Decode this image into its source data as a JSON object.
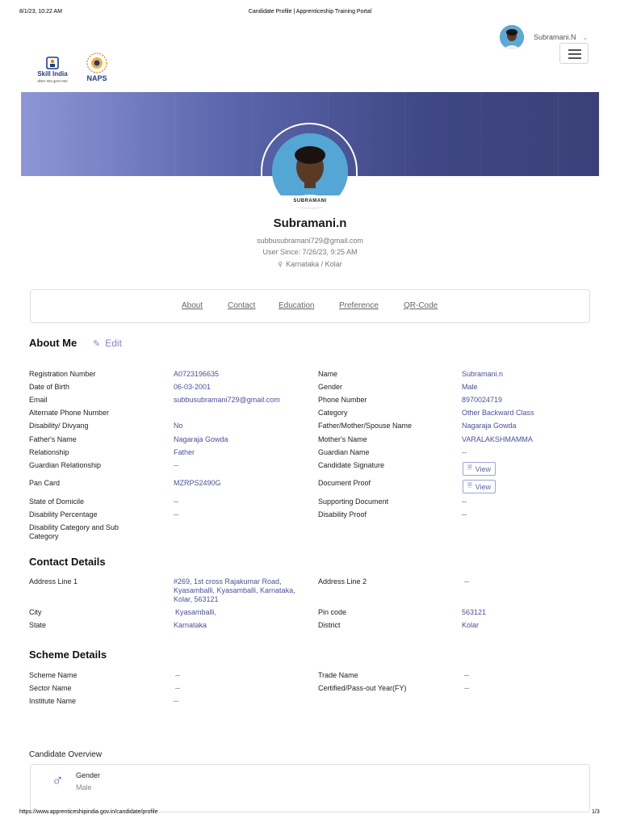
{
  "print": {
    "datetime": "8/1/23, 10:22 AM",
    "page_title": "Candidate Profile | Apprenticeship Training Portal",
    "url": "https://www.apprenticeshipindia.gov.in/candidate/profile",
    "page_number": "1/3"
  },
  "header": {
    "user_name": "Subramani.N",
    "logo_skill_text": "Skill India",
    "logo_skill_sub": "कौशल भारत-कुशल भारत",
    "logo_naps_text": "NAPS"
  },
  "profile": {
    "photo_caption": "SUBRAMANI",
    "name": "Subramani.n",
    "email": "subbusubramani729@gmail.com",
    "user_since": "User Since: 7/26/23, 9:25 AM",
    "location": "Karnataka / Kolar"
  },
  "tabs": [
    "About",
    "Contact",
    "Education",
    "Preference",
    "QR-Code"
  ],
  "about": {
    "title": "About Me",
    "edit_label": "Edit",
    "left": [
      {
        "label": "Registration Number",
        "value": "A0723196635"
      },
      {
        "label": "Date of Birth",
        "value": "06-03-2001"
      },
      {
        "label": "Email",
        "value": "subbusubramani729@gmail.com"
      },
      {
        "label": "Alternate Phone Number",
        "value": ""
      },
      {
        "label": "Disability/ Divyang",
        "value": "No"
      },
      {
        "label": "Father's Name",
        "value": "Nagaraja Gowda"
      },
      {
        "label": "Relationship",
        "value": "Father"
      },
      {
        "label": "Guardian Relationship",
        "value": "--"
      },
      {
        "label": "Pan Card",
        "value": "MZRPS2490G"
      },
      {
        "label": "State of Domicile",
        "value": "--"
      },
      {
        "label": "Disability Percentage",
        "value": "--"
      },
      {
        "label": "Disability Category and Sub Category",
        "value": ""
      }
    ],
    "right": [
      {
        "label": "Name",
        "value": "Subramani.n"
      },
      {
        "label": "Gender",
        "value": "Male"
      },
      {
        "label": "Phone Number",
        "value": "8970024719"
      },
      {
        "label": "Category",
        "value": "Other Backward Class"
      },
      {
        "label": "Father/Mother/Spouse Name",
        "value": "Nagaraja Gowda"
      },
      {
        "label": "Mother's Name",
        "value": "VARALAKSHMAMMA"
      },
      {
        "label": "Guardian Name",
        "value": "--"
      },
      {
        "label": "Candidate Signature",
        "value": "View"
      },
      {
        "label": "Document Proof",
        "value": "View"
      },
      {
        "label": "Supporting Document",
        "value": "--"
      },
      {
        "label": "Disability Proof",
        "value": "--"
      }
    ]
  },
  "contact": {
    "title": "Contact Details",
    "address1_label": "Address Line 1",
    "address1_lines": [
      "#269, 1st cross Rajakumar Road,",
      "Kyasamballi, Kyasamballi, Karnataka,",
      "Kolar, 563121"
    ],
    "address2_label": "Address Line 2",
    "address2_value": "--",
    "city_label": "City",
    "city_value": "Kyasamballi,",
    "pin_label": "Pin code",
    "pin_value": "563121",
    "state_label": "State",
    "state_value": "Karnataka",
    "district_label": "District",
    "district_value": "Kolar"
  },
  "scheme": {
    "title": "Scheme Details",
    "scheme_name_label": "Scheme Name",
    "scheme_name_value": "--",
    "trade_label": "Trade Name",
    "trade_value": "--",
    "sector_label": "Sector Name",
    "sector_value": "--",
    "certified_label": "Certified/Pass-out Year(FY)",
    "certified_value": "--",
    "institute_label": "Institute Name",
    "institute_value": "--"
  },
  "overview": {
    "title": "Candidate Overview",
    "gender_label": "Gender",
    "gender_value": "Male"
  },
  "colors": {
    "accent": "#4a4f9c",
    "edit": "#8a7fd1",
    "banner_start": "#8d97d6",
    "banner_end": "#3a4079"
  }
}
